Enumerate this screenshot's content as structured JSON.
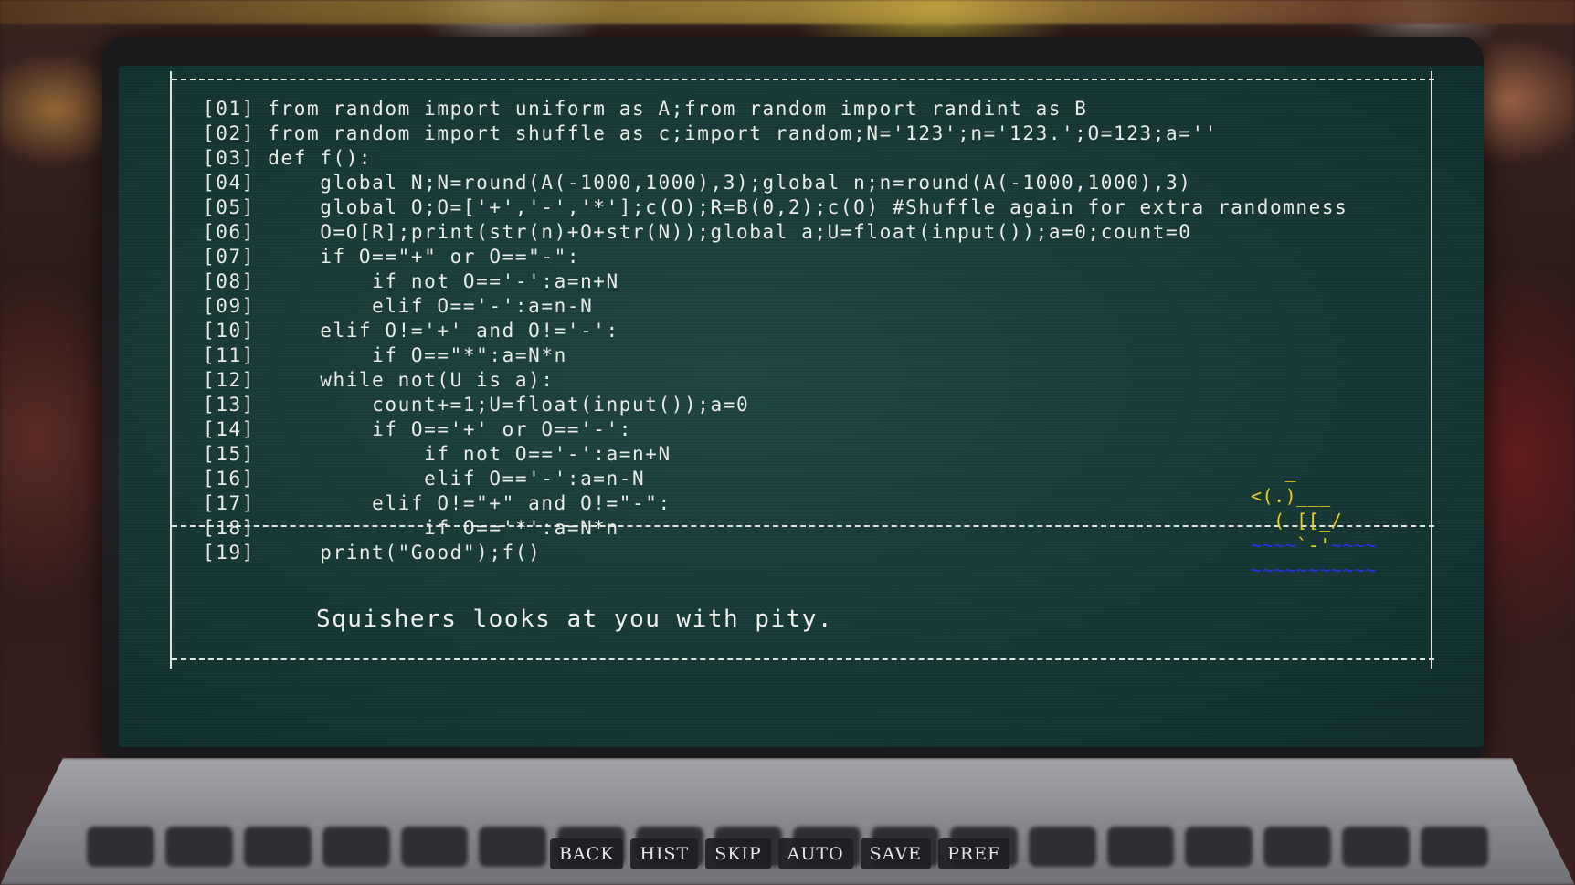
{
  "code_lines": [
    {
      "num": "[01]",
      "text": "from random import uniform as A;from random import randint as B"
    },
    {
      "num": "[02]",
      "text": "from random import shuffle as c;import random;N='123';n='123.';O=123;a=''"
    },
    {
      "num": "[03]",
      "text": "def f():"
    },
    {
      "num": "[04]",
      "text": "    global N;N=round(A(-1000,1000),3);global n;n=round(A(-1000,1000),3)"
    },
    {
      "num": "[05]",
      "text": "    global O;O=['+','-','*'];c(O);R=B(0,2);c(O) #Shuffle again for extra randomness"
    },
    {
      "num": "[06]",
      "text": "    O=O[R];print(str(n)+O+str(N));global a;U=float(input());a=0;count=0"
    },
    {
      "num": "[07]",
      "text": "    if O==\"+\" or O==\"-\":"
    },
    {
      "num": "[08]",
      "text": "        if not O=='-':a=n+N"
    },
    {
      "num": "[09]",
      "text": "        elif O=='-':a=n-N"
    },
    {
      "num": "[10]",
      "text": "    elif O!='+' and O!='-':"
    },
    {
      "num": "[11]",
      "text": "        if O==\"*\":a=N*n"
    },
    {
      "num": "[12]",
      "text": "    while not(U is a):"
    },
    {
      "num": "[13]",
      "text": "        count+=1;U=float(input());a=0"
    },
    {
      "num": "[14]",
      "text": "        if O=='+' or O=='-':"
    },
    {
      "num": "[15]",
      "text": "            if not O=='-':a=n+N"
    },
    {
      "num": "[16]",
      "text": "            elif O=='-':a=n-N"
    },
    {
      "num": "[17]",
      "text": "        elif O!=\"+\" and O!=\"-\":"
    },
    {
      "num": "[18]",
      "text": "            if O=='*':a=N*n"
    },
    {
      "num": "[19]",
      "text": "    print(\"Good\");f()"
    }
  ],
  "dialogue": {
    "text": "Squishers looks at you with pity."
  },
  "duck_art": {
    "line1": "   _",
    "line2": "<(.)___",
    "line3": "  ( [[_/",
    "water1_a": "~~~~",
    "water1_b": "`-'",
    "water1_c": "~~~~",
    "water2": "~~~~~~~~~~~"
  },
  "quick_menu": {
    "back": "BACK",
    "history": "HIST",
    "skip": "SKIP",
    "auto": "AUTO",
    "save": "SAVE",
    "prefs": "PREF"
  },
  "colors": {
    "screen": "#18403d",
    "duck": "#e8d21c",
    "water": "#2233ee"
  }
}
